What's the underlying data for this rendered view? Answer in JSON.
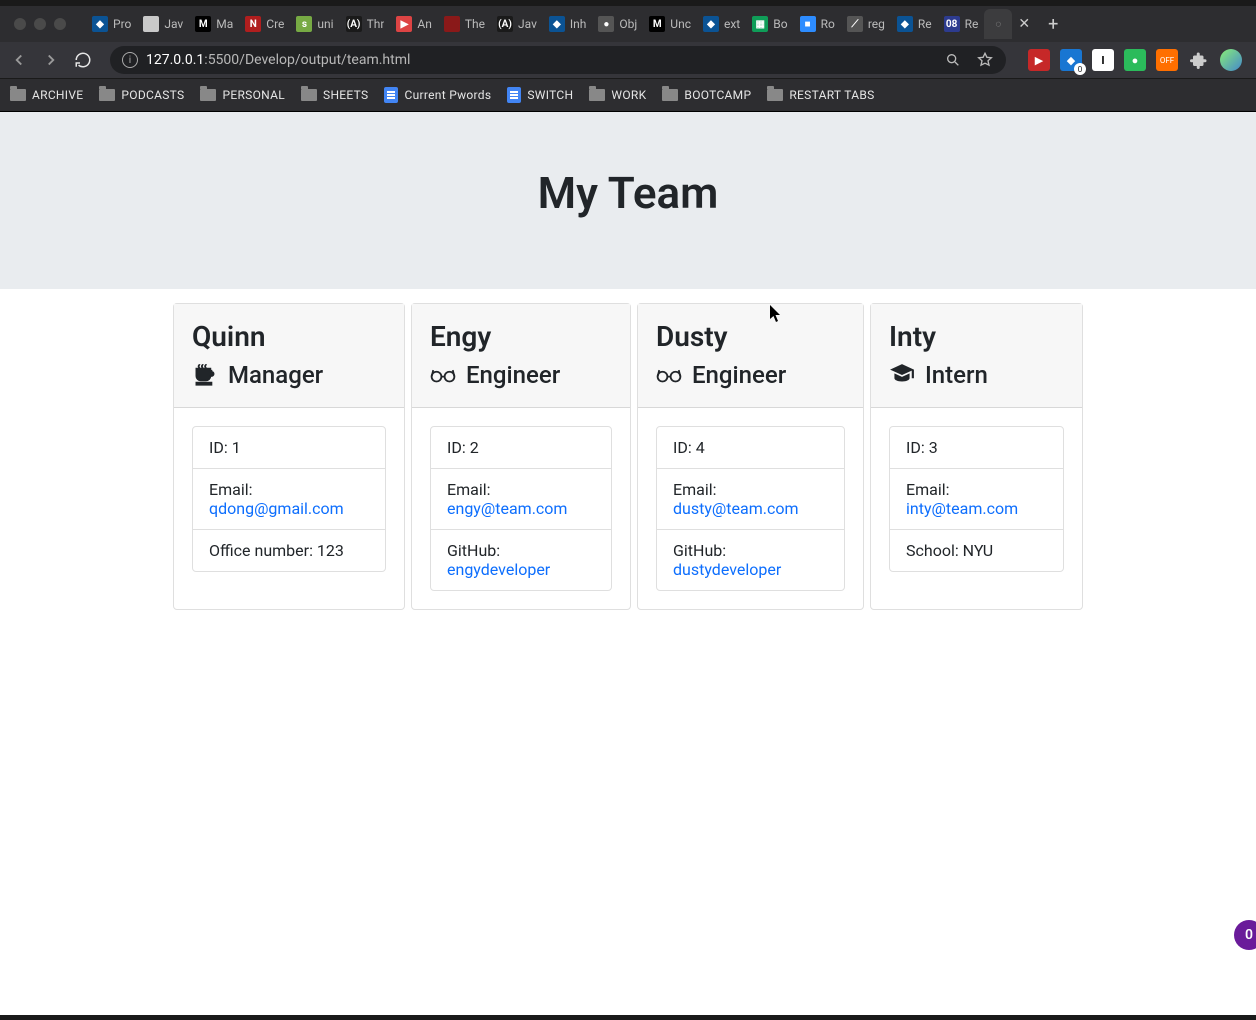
{
  "browser": {
    "url_domain": "127.0.0.1",
    "url_port": ":5500",
    "url_path": "/Develop/output/team.html",
    "tabs": [
      {
        "label": "Pro",
        "favicon_bg": "#0b5394",
        "favicon_text": "◆"
      },
      {
        "label": "Jav",
        "favicon_bg": "#c9c9c9",
        "favicon_text": ""
      },
      {
        "label": "Ma",
        "favicon_bg": "#000",
        "favicon_text": "M"
      },
      {
        "label": "Cre",
        "favicon_bg": "#b01e1e",
        "favicon_text": "N"
      },
      {
        "label": "uni",
        "favicon_bg": "#7a4",
        "favicon_text": "s"
      },
      {
        "label": "Thr",
        "favicon_bg": "#1a1a1a",
        "favicon_text": "(A)"
      },
      {
        "label": "An",
        "favicon_bg": "#d44",
        "favicon_text": "▶"
      },
      {
        "label": "The",
        "favicon_bg": "#8a1919",
        "favicon_text": ""
      },
      {
        "label": "Jav",
        "favicon_bg": "#1a1a1a",
        "favicon_text": "(A)"
      },
      {
        "label": "Inh",
        "favicon_bg": "#0b5394",
        "favicon_text": "◆"
      },
      {
        "label": "Obj",
        "favicon_bg": "#555",
        "favicon_text": "●"
      },
      {
        "label": "Unc",
        "favicon_bg": "#000",
        "favicon_text": "M"
      },
      {
        "label": "ext",
        "favicon_bg": "#0b5394",
        "favicon_text": "◆"
      },
      {
        "label": "Bo",
        "favicon_bg": "#0f9d58",
        "favicon_text": "▦"
      },
      {
        "label": "Ro",
        "favicon_bg": "#2d8cff",
        "favicon_text": "■"
      },
      {
        "label": "reg",
        "favicon_bg": "#555",
        "favicon_text": "⟋"
      },
      {
        "label": "Re",
        "favicon_bg": "#0b5394",
        "favicon_text": "◆"
      },
      {
        "label": "Re",
        "favicon_bg": "#2d3b8f",
        "favicon_text": "08"
      }
    ],
    "active_tab_index": 18,
    "bookmarks": [
      {
        "label": "ARCHIVE",
        "type": "folder"
      },
      {
        "label": "PODCASTS",
        "type": "folder"
      },
      {
        "label": "PERSONAL",
        "type": "folder"
      },
      {
        "label": "SHEETS",
        "type": "folder"
      },
      {
        "label": "Current Pwords",
        "type": "doc"
      },
      {
        "label": "SWITCH",
        "type": "doc"
      },
      {
        "label": "WORK",
        "type": "folder"
      },
      {
        "label": "BOOTCAMP",
        "type": "folder"
      },
      {
        "label": "RESTART TABS",
        "type": "folder"
      }
    ],
    "ext_badge": "0",
    "floating_badge": "0"
  },
  "page": {
    "title": "My Team",
    "labels": {
      "id": "ID: ",
      "email": "Email: ",
      "office": "Office number: ",
      "github": "GitHub: ",
      "school": "School: "
    },
    "members": [
      {
        "name": "Quinn",
        "role": "Manager",
        "icon": "mug",
        "id": "1",
        "email": "qdong@gmail.com",
        "extra_label": "office",
        "extra_value": "123",
        "extra_link": false
      },
      {
        "name": "Engy",
        "role": "Engineer",
        "icon": "glasses",
        "id": "2",
        "email": "engy@team.com",
        "extra_label": "github",
        "extra_value": "engydeveloper",
        "extra_link": true
      },
      {
        "name": "Dusty",
        "role": "Engineer",
        "icon": "glasses",
        "id": "4",
        "email": "dusty@team.com",
        "extra_label": "github",
        "extra_value": "dustydeveloper",
        "extra_link": true
      },
      {
        "name": "Inty",
        "role": "Intern",
        "icon": "grad",
        "id": "3",
        "email": "inty@team.com",
        "extra_label": "school",
        "extra_value": "NYU",
        "extra_link": false
      }
    ]
  }
}
